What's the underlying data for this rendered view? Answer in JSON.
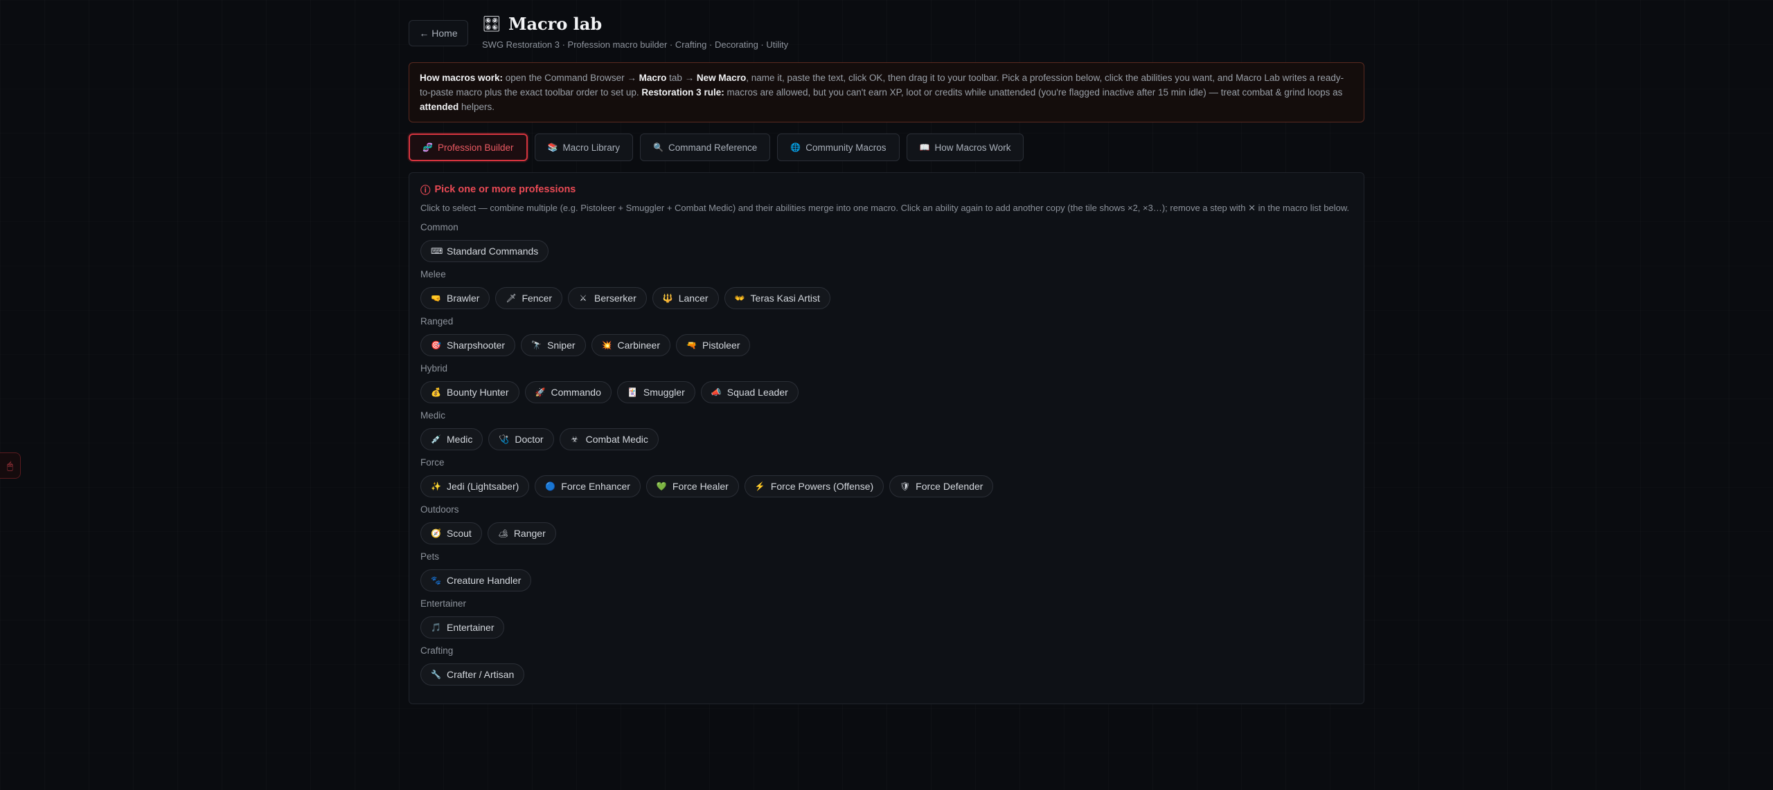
{
  "header": {
    "home_label": "← Home",
    "title_icon": "🎛",
    "title": "Macro lab",
    "subtitle": "SWG Restoration 3 · Profession macro builder · Crafting · Decorating · Utility"
  },
  "notice": {
    "p1_bold": "How macros work:",
    "p1_text": " open the Command Browser → ",
    "p1_macro": "Macro",
    "p1_tab": " tab → ",
    "p1_new": "New Macro",
    "p1_rest": ", name it, paste the text, click OK, then drag it to your toolbar. Pick a profession below, click the abilities you want, and Macro Lab writes a ready-to-paste macro plus the exact toolbar order to set up. ",
    "p2_bold": "Restoration 3 rule:",
    "p2_text": " macros are allowed, but you can't earn XP, loot or credits while unattended (you're flagged inactive after 15 min idle) — treat combat & grind loops as ",
    "p2_attended": "attended",
    "p2_end": " helpers."
  },
  "tabs": [
    {
      "icon": "🧬",
      "label": "Profession Builder",
      "active": true
    },
    {
      "icon": "📚",
      "label": "Macro Library"
    },
    {
      "icon": "🔍",
      "label": "Command Reference"
    },
    {
      "icon": "🌐",
      "label": "Community Macros"
    },
    {
      "icon": "📖",
      "label": "How Macros Work"
    }
  ],
  "panel": {
    "warn_icon": "ⓘ",
    "warn": "Pick one or more professions",
    "hint": "Click to select — combine multiple (e.g. Pistoleer + Smuggler + Combat Medic) and their abilities merge into one macro. Click an ability again to add another copy (the tile shows ×2, ×3…); remove a step with ✕ in the macro list below."
  },
  "groups": [
    {
      "label": "Common",
      "items": [
        {
          "icon": "⌨",
          "label": "Standard Commands"
        }
      ]
    },
    {
      "label": "Melee",
      "items": [
        {
          "icon": "🤜",
          "label": "Brawler"
        },
        {
          "icon": "🗡",
          "label": "Fencer"
        },
        {
          "icon": "⚔",
          "label": "Berserker"
        },
        {
          "icon": "🔱",
          "label": "Lancer"
        },
        {
          "icon": "👐",
          "label": "Teras Kasi Artist"
        }
      ]
    },
    {
      "label": "Ranged",
      "items": [
        {
          "icon": "🎯",
          "label": "Sharpshooter"
        },
        {
          "icon": "🔭",
          "label": "Sniper"
        },
        {
          "icon": "💥",
          "label": "Carbineer"
        },
        {
          "icon": "🔫",
          "label": "Pistoleer"
        }
      ]
    },
    {
      "label": "Hybrid",
      "items": [
        {
          "icon": "💰",
          "label": "Bounty Hunter"
        },
        {
          "icon": "🚀",
          "label": "Commando"
        },
        {
          "icon": "🃏",
          "label": "Smuggler"
        },
        {
          "icon": "📣",
          "label": "Squad Leader"
        }
      ]
    },
    {
      "label": "Medic",
      "items": [
        {
          "icon": "💉",
          "label": "Medic"
        },
        {
          "icon": "🩺",
          "label": "Doctor"
        },
        {
          "icon": "☣",
          "label": "Combat Medic"
        }
      ]
    },
    {
      "label": "Force",
      "items": [
        {
          "icon": "✨",
          "label": "Jedi (Lightsaber)"
        },
        {
          "icon": "🔵",
          "label": "Force Enhancer"
        },
        {
          "icon": "💚",
          "label": "Force Healer"
        },
        {
          "icon": "⚡",
          "label": "Force Powers (Offense)"
        },
        {
          "icon": "🛡",
          "label": "Force Defender"
        }
      ]
    },
    {
      "label": "Outdoors",
      "items": [
        {
          "icon": "🧭",
          "label": "Scout"
        },
        {
          "icon": "🏕",
          "label": "Ranger"
        }
      ]
    },
    {
      "label": "Pets",
      "items": [
        {
          "icon": "🐾",
          "label": "Creature Handler"
        }
      ]
    },
    {
      "label": "Entertainer",
      "items": [
        {
          "icon": "🎵",
          "label": "Entertainer"
        }
      ]
    },
    {
      "label": "Crafting",
      "items": [
        {
          "icon": "🔧",
          "label": "Crafter / Artisan"
        }
      ]
    }
  ],
  "side_tab_icon": "🖱"
}
